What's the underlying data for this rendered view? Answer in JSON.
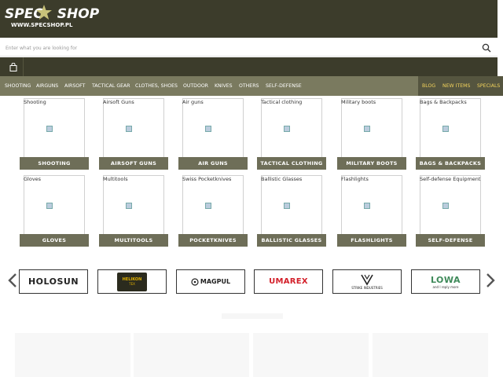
{
  "header": {
    "logo_main": "SPEC SHOP",
    "logo_left": "SPEC",
    "logo_right": "SHOP",
    "logo_sub": "WWW.SPECSHOP.PL"
  },
  "search": {
    "placeholder": "Enter what you are looking for"
  },
  "nav": {
    "items": [
      "SHOOTING",
      "AIRGUNS",
      "AIRSOFT",
      "TACTICAL GEAR",
      "CLOTHES, SHOES",
      "OUTDOOR",
      "KNIVES",
      "OTHERS",
      "SELF-DEFENSE"
    ],
    "right_items": [
      "BLOG",
      "NEW ITEMS",
      "SPECIALS"
    ]
  },
  "categories": [
    {
      "title": "Shooting",
      "button": "SHOOTING"
    },
    {
      "title": "Airsoft Guns",
      "button": "AIRSOFT GUNS"
    },
    {
      "title": "Air guns",
      "button": "AIR GUNS"
    },
    {
      "title": "Tactical clothing",
      "button": "TACTICAL CLOTHING"
    },
    {
      "title": "Military boots",
      "button": "MILITARY BOOTS"
    },
    {
      "title": "Bags & Backpacks",
      "button": "BAGS & BACKPACKS"
    },
    {
      "title": "Gloves",
      "button": "GLOVES"
    },
    {
      "title": "Multitools",
      "button": "MULTITOOLS"
    },
    {
      "title": "Swiss Pocketknives",
      "button": "POCKETKNIVES"
    },
    {
      "title": "Ballistic Glasses",
      "button": "BALLISTIC GLASSES"
    },
    {
      "title": "Flashlights",
      "button": "FLASHLIGHTS"
    },
    {
      "title": "Self-defense Equipment",
      "button": "SELF-DEFENSE"
    }
  ],
  "brands": {
    "holosun": "HOLOSUN",
    "helikon_line1": "HELIKON",
    "helikon_line2": "TEX",
    "magpul": "MAGPUL",
    "umarex": "UMAREX",
    "strike_line1": "STRIKE INDUSTRIES",
    "lowa": "LOWA",
    "lowa_tag": "and I reply more"
  },
  "colors": {
    "header_bg": "#3c3c2b",
    "nav_bg": "#7a7a5f",
    "nav_accent": "#f3d35c",
    "category_button": "#6e6e58",
    "logo_star": "#c8c27a"
  }
}
